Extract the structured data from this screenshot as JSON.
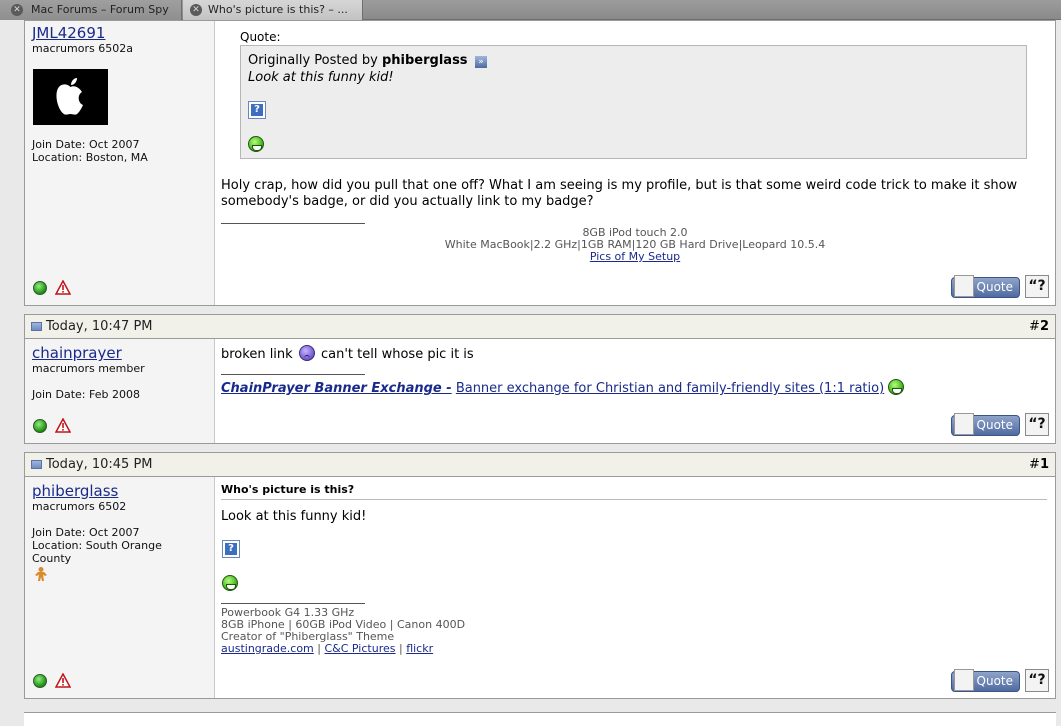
{
  "tabs": [
    {
      "label": "Mac Forums – Forum Spy"
    },
    {
      "label": "Who's picture is this? – ..."
    }
  ],
  "posts": [
    {
      "username": "JML42691",
      "user_title": "macrumors 6502a",
      "join_date": "Join Date: Oct 2007",
      "location": "Location: Boston, MA",
      "quote_label": "Quote:",
      "quote_prefix": "Originally Posted by",
      "quote_author": "phiberglass",
      "quote_text": "Look at this funny kid!",
      "body": "Holy crap, how did you pull that one off? What I am seeing is my profile, but is that some weird code trick to make it show somebody's badge, or did you actually link to my badge?",
      "sig": [
        "8GB iPod touch 2.0",
        "White MacBook|2.2 GHz|1GB RAM|120 GB Hard Drive|Leopard 10.5.4",
        "Pics of My Setup"
      ]
    },
    {
      "date": "Today, 10:47 PM",
      "number": "2",
      "username": "chainprayer",
      "user_title": "macrumors member",
      "join_date": "Join Date: Feb 2008",
      "body_part1": "broken link",
      "body_part2": "can't tell whose pic it is",
      "banner_title": "ChainPrayer Banner Exchange -",
      "banner_text": "Banner exchange for Christian and family-friendly sites (1:1 ratio)"
    },
    {
      "date": "Today, 10:45 PM",
      "number": "1",
      "username": "phiberglass",
      "user_title": "macrumors 6502",
      "join_date": "Join Date: Oct 2007",
      "location_line1": "Location: South Orange",
      "location_line2": "County",
      "subject": "Who's picture is this?",
      "body": "Look at this funny kid!",
      "sig": [
        "Powerbook G4 1.33 GHz",
        "8GB iPhone | 60GB iPod Video | Canon 400D",
        "Creator of \"Phiberglass\" Theme"
      ],
      "sig_links": [
        "austingrade.com",
        "C&C Pictures",
        "flickr"
      ]
    }
  ],
  "buttons": {
    "quote": "Quote",
    "multiquote": "“?"
  },
  "post_number_prefix": "#",
  "icons": [
    "close-icon",
    "apple-logo",
    "online-status-icon",
    "report-icon",
    "view-post-icon",
    "image-placeholder-icon",
    "grin-smiley-icon",
    "frown-smiley-icon",
    "post-doc-icon",
    "gingerbread-badge-icon"
  ],
  "colors": {
    "link": "#1a2a8a",
    "header_bg": "#f1f1ea",
    "quote_bg": "#ededed",
    "quote_button": "#4f6aa0"
  }
}
